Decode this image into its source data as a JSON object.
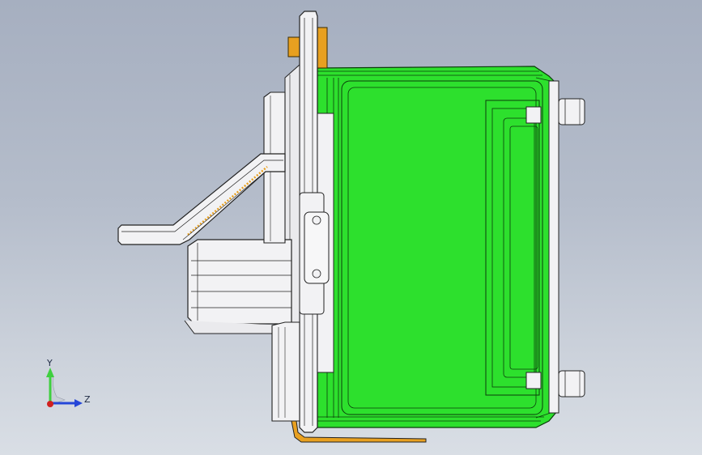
{
  "viewport": {
    "background_top": "#a6afc0",
    "background_bottom": "#d9dee5",
    "model": {
      "body_color": "#2de02d",
      "body_edge_color": "#0b3d0b",
      "metal_color": "#f2f2f4",
      "accent_color": "#e8a020",
      "line_color": "#222222"
    },
    "triad": {
      "y_label": "Y",
      "z_label": "Z",
      "y_color": "#3fcf3f",
      "z_color": "#2546d8",
      "origin_color": "#d02020"
    }
  }
}
